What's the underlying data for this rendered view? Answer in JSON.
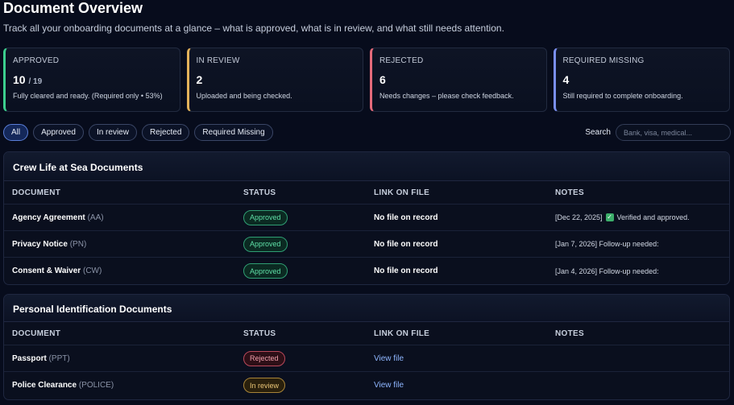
{
  "header": {
    "title": "Document Overview",
    "subtitle": "Track all your onboarding documents at a glance – what is approved, what is in review, and what still needs attention."
  },
  "cards": [
    {
      "label": "APPROVED",
      "value": "10",
      "sub": "/ 19",
      "desc": "Fully cleared and ready. (Required only • 53%)",
      "color": "#3ccf8e"
    },
    {
      "label": "IN REVIEW",
      "value": "2",
      "desc": "Uploaded and being checked.",
      "color": "#e3b25a"
    },
    {
      "label": "REJECTED",
      "value": "6",
      "desc": "Needs changes – please check feedback.",
      "color": "#e46a7a"
    },
    {
      "label": "REQUIRED MISSING",
      "value": "4",
      "desc": "Still required to complete onboarding.",
      "color": "#7a8ff0"
    }
  ],
  "filters": [
    "All",
    "Approved",
    "In review",
    "Rejected",
    "Required Missing"
  ],
  "search": {
    "label": "Search",
    "placeholder": "Bank, visa, medical..."
  },
  "columns": [
    "DOCUMENT",
    "STATUS",
    "LINK ON FILE",
    "NOTES"
  ],
  "sections": [
    {
      "title": "Crew Life at Sea Documents",
      "rows": [
        {
          "name": "Agency Agreement",
          "code": "(AA)",
          "status": "Approved",
          "link": "No file on record",
          "notes": "[Dec 22, 2025]",
          "notes_tail": "Verified and approved.",
          "check_icon": "check-square-icon"
        },
        {
          "name": "Privacy Notice",
          "code": "(PN)",
          "status": "Approved",
          "link": "No file on record",
          "notes": "[Jan 7, 2026] Follow-up needed:"
        },
        {
          "name": "Consent & Waiver",
          "code": "(CW)",
          "status": "Approved",
          "link": "No file on record",
          "notes": "[Jan 4, 2026] Follow-up needed:"
        }
      ]
    },
    {
      "title": "Personal Identification Documents",
      "rows": [
        {
          "name": "Passport",
          "code": "(PPT)",
          "status": "Rejected",
          "link": "View file",
          "notes": ""
        },
        {
          "name": "Police Clearance",
          "code": "(POLICE)",
          "status": "In review",
          "link": "View file",
          "notes": ""
        }
      ]
    }
  ],
  "colors": {
    "approved": "#3ccf8e",
    "review": "#e3b25a",
    "rejected": "#e46a7a",
    "missing": "#7a8ff0",
    "background": "#070c1c"
  }
}
